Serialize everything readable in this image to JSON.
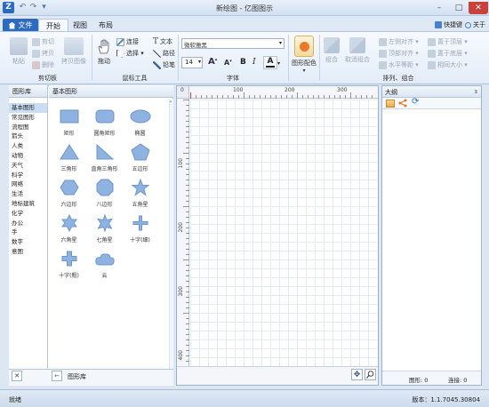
{
  "window": {
    "title": "新绘图 - 亿图图示"
  },
  "quick_access": {
    "undo": "↶",
    "redo": "↷",
    "more": "▾"
  },
  "window_buttons": {
    "minimize": "–",
    "maximize": "□",
    "close": "✕"
  },
  "tabs": {
    "file": "文件",
    "start": "开始",
    "view": "视图",
    "layout": "布局"
  },
  "top_right": {
    "shortcut": "快捷键",
    "about": "关于"
  },
  "ribbon": {
    "clipboard": {
      "paste": "粘贴",
      "cut": "剪切",
      "copy": "拷贝",
      "delete": "删除",
      "copy_image": "拷贝图像",
      "label": "剪切板"
    },
    "mouse_tools": {
      "drag": "拖动",
      "connect": "连接",
      "select": "选择",
      "text": "文本",
      "path": "路径",
      "pencil": "铅笔",
      "label": "鼠标工具"
    },
    "font": {
      "family": "微软雅黑",
      "size": "14",
      "grow": "A",
      "shrink": "A",
      "bold": "B",
      "italic": "I",
      "color": "A",
      "label": "字体"
    },
    "shape_color": {
      "label": "图形配色"
    },
    "arrange": {
      "group": "组合",
      "ungroup": "取消组合",
      "align_left": "左侧对齐",
      "align_top": "顶部对齐",
      "distribute_h": "水平等距",
      "bring_front": "置于顶层",
      "send_back": "置于底层",
      "same_size": "相同大小",
      "label": "排列、组合"
    }
  },
  "left_panel": {
    "lib_header": "图形库",
    "shapes_header": "基本图形",
    "categories": [
      "基本图形",
      "常见图形",
      "流程图",
      "箭头",
      "人类",
      "动物",
      "天气",
      "科学",
      "网络",
      "生活",
      "地标建筑",
      "化学",
      "办公",
      "手",
      "数字",
      "意图"
    ],
    "shapes": [
      "矩形",
      "圆角矩形",
      "椭圆",
      "三角形",
      "直角三角形",
      "五边形",
      "六边形",
      "八边形",
      "五角星",
      "六角星",
      "七角星",
      "十字(细)",
      "十字(粗)",
      "云"
    ],
    "footer_label": "图形库",
    "close_icon": "✕",
    "back_icon": "←"
  },
  "canvas": {
    "h_ticks": [
      "0",
      "100",
      "200",
      "300"
    ],
    "v_ticks": [
      "100",
      "200",
      "300",
      "400"
    ]
  },
  "outline": {
    "title": "大纲",
    "pin": "ɜ",
    "shape_count": "图形: 0",
    "connector_count": "连接: 0"
  },
  "status": {
    "left": "就绪",
    "version": "版本：1.1.7045.30804"
  }
}
